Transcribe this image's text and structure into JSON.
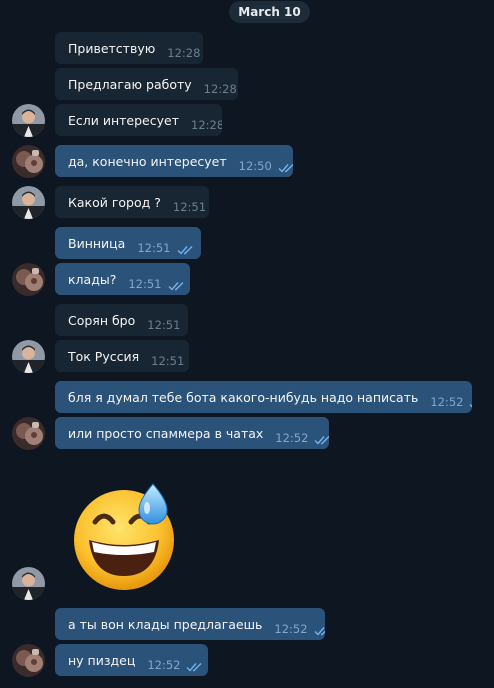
{
  "chat": {
    "date_label": "March 10",
    "messages": [
      {
        "text": "Приветствую",
        "time": "12:28"
      },
      {
        "text": "Предлагаю работу",
        "time": "12:28"
      },
      {
        "text": "Если интересует",
        "time": "12:28"
      },
      {
        "text": "да, конечно интересует",
        "time": "12:50"
      },
      {
        "text": "Какой город ?",
        "time": "12:51"
      },
      {
        "text": "Винница",
        "time": "12:51"
      },
      {
        "text": "клады?",
        "time": "12:51"
      },
      {
        "text": "Сорян бро",
        "time": "12:51"
      },
      {
        "text": "Ток Руссия",
        "time": "12:51"
      },
      {
        "text": "бля я думал тебе бота какого-нибудь надо написать",
        "time": "12:52"
      },
      {
        "text": "или просто спаммера в чатах",
        "time": "12:52"
      },
      {
        "text": "а ты вон клады предлагаешь",
        "time": "12:52"
      },
      {
        "text": "ну пиздец",
        "time": "12:52"
      }
    ],
    "sticker": "grinning-sweat-emoji",
    "colors": {
      "background": "#0e1621",
      "incoming_bubble": "#182533",
      "outgoing_bubble": "#2b5278",
      "read_ticks": "#6fb3f0"
    }
  }
}
